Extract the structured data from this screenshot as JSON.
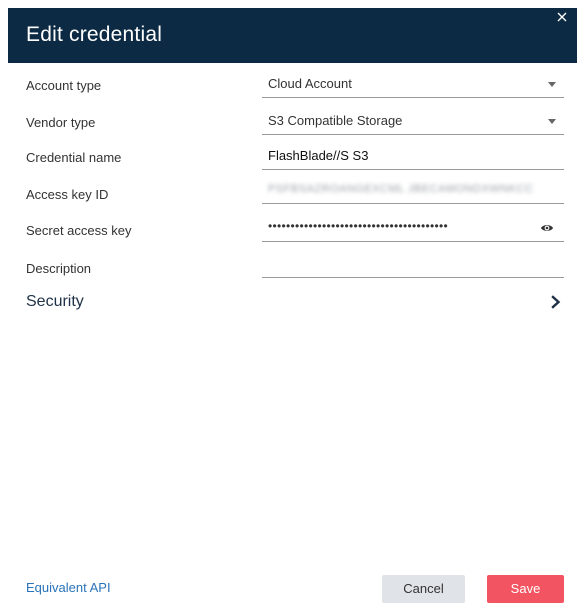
{
  "dialog": {
    "title": "Edit credential",
    "close_icon": "close-icon"
  },
  "form": {
    "account_type": {
      "label": "Account type",
      "value": "Cloud Account"
    },
    "vendor_type": {
      "label": "Vendor type",
      "value": "S3 Compatible Storage"
    },
    "credential_name": {
      "label": "Credential name",
      "value": "FlashBlade//S S3"
    },
    "access_key_id": {
      "label": "Access key ID",
      "value": "PSFBSAZROANGEXCML JBECAMONDXWNKCC"
    },
    "secret_access_key": {
      "label": "Secret access key",
      "value": "••••••••••••••••••••••••••••••••••••••••"
    },
    "description": {
      "label": "Description",
      "value": ""
    }
  },
  "security": {
    "label": "Security"
  },
  "footer": {
    "api_link": "Equivalent API",
    "cancel_label": "Cancel",
    "save_label": "Save"
  },
  "colors": {
    "header_bg": "#0c2a43",
    "save_bg": "#f25561",
    "cancel_bg": "#e0e3e7",
    "link": "#2a73b8"
  }
}
